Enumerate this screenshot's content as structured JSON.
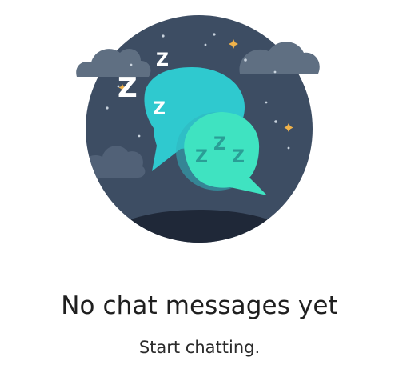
{
  "empty_state": {
    "title": "No chat messages yet",
    "subtitle": "Start chatting."
  },
  "illustration": {
    "icon": "sleeping-chat-bubbles-icon",
    "sleep_letters": [
      "Z",
      "Z",
      "Z"
    ],
    "bubble_letters": [
      "Z",
      "Z",
      "Z"
    ]
  },
  "colors": {
    "night_sky": "#3d4d63",
    "ground": "#1f2838",
    "cloud": "#5f6f82",
    "bubble_back": "#2fc9cf",
    "bubble_front": "#3fe3c1",
    "bubble_text": "#2a9e96",
    "star": "#f0b24a",
    "title_text": "#1f1f1f"
  }
}
